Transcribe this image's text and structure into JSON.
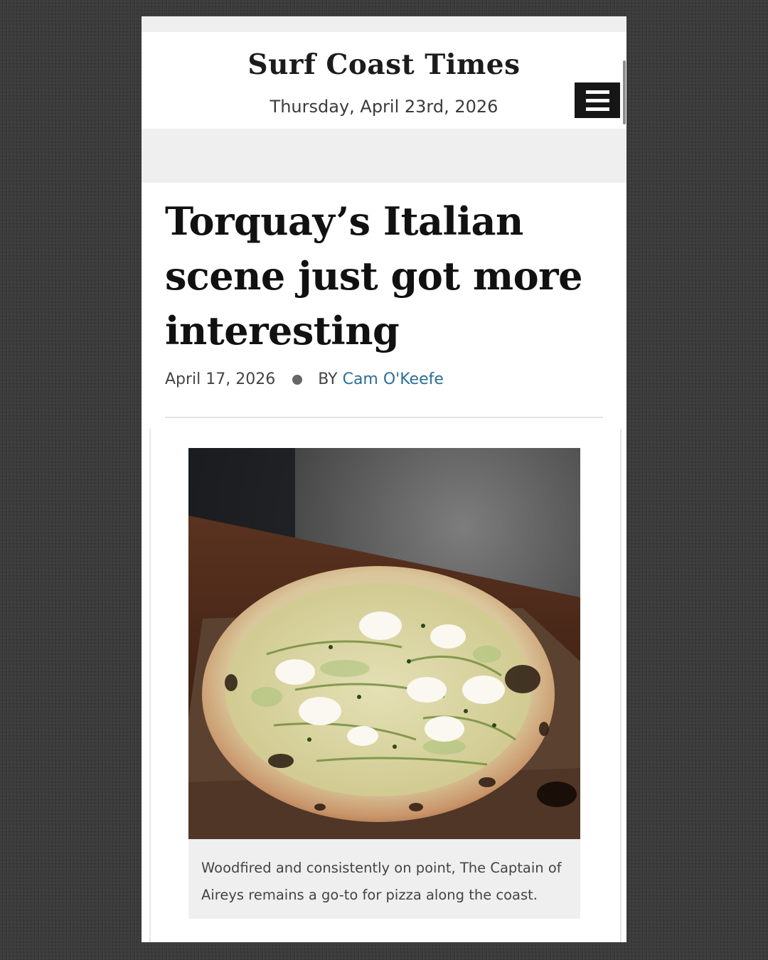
{
  "site": {
    "masthead": "Surf Coast Times",
    "date": "Thursday, April 23rd, 2026"
  },
  "header": {
    "menu_icon": "hamburger-menu-icon"
  },
  "article": {
    "headline": "Torquay’s Italian scene just got more interesting",
    "published": "April 17, 2026",
    "byline_prefix": "BY",
    "author": "Cam O'Keefe",
    "author_color": "#2b6e96"
  },
  "figure": {
    "caption": "Woodfired and consistently on point, The Captain of Aireys remains a go-to for pizza along the coast."
  }
}
